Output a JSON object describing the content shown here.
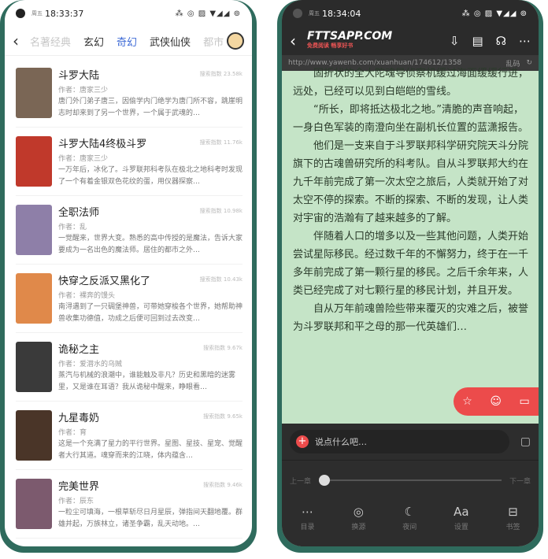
{
  "left": {
    "status": {
      "time": "18:33:37",
      "small": "周五",
      "icons": "⁂ ◎ ▨ ▼◢◢ ⊚"
    },
    "tabs": [
      {
        "label": "名著经典",
        "style": "faded"
      },
      {
        "label": "玄幻",
        "style": "normal"
      },
      {
        "label": "奇幻",
        "style": "active"
      },
      {
        "label": "武侠仙侠",
        "style": "normal"
      },
      {
        "label": "都市",
        "style": "faded"
      }
    ],
    "books": [
      {
        "title": "斗罗大陆",
        "author": "作者：唐家三少",
        "index": "搜索指数 23.58k",
        "desc": "唐门外门弟子唐三，因偷学内门绝学为唐门所不容，跳崖明志时却来到了另一个世界，一个属于武魂的…",
        "cover": "#7a6655"
      },
      {
        "title": "斗罗大陆4终极斗罗",
        "author": "作者：唐家三少",
        "index": "搜索指数 11.76k",
        "desc": "一万年后，冰化了。斗罗联邦科考队在极北之地科考时发现了一个有着金银双色花纹的蛋，用仪器探察…",
        "cover": "#c0392b"
      },
      {
        "title": "全职法师",
        "author": "作者：乱",
        "index": "搜索指数 10.98k",
        "desc": "一觉醒来，世界大变。熟悉的高中传授的是魔法，告诉大家要成为一名出色的魔法师。居住的都市之外…",
        "cover": "#8e7fa8"
      },
      {
        "title": "快穿之反派又黑化了",
        "author": "作者：裸奔的馒头",
        "index": "搜索指数 10.43k",
        "desc": "南浔遇到了一只碉堡神兽，可带她穿梭各个世界，她帮助神兽收集功德值，功成之后便可回到过去改变…",
        "cover": "#e0894a"
      },
      {
        "title": "诡秘之主",
        "author": "作者：爱潜水的乌贼",
        "index": "搜索指数 9.67k",
        "desc": "蒸汽与机械的浪潮中，谁能触及非凡？历史和黑暗的迷雾里，又是谁在耳语？我从诡秘中醒来，睁眼看…",
        "cover": "#3a3a3a"
      },
      {
        "title": "九星毒奶",
        "author": "作者：育",
        "index": "搜索指数 9.65k",
        "desc": "这是一个充满了星力的平行世界。星图、星技、星宠、觉醒者大行其道。魂穿而来的江晓，体内蕴含…",
        "cover": "#4a3528"
      },
      {
        "title": "完美世界",
        "author": "作者：辰东",
        "index": "搜索指数 9.46k",
        "desc": "一粒尘可填海，一根草斩尽日月星辰，弹指间天翻地覆。群雄并起，万族林立，诸圣争霸，乱天动地。…",
        "cover": "#7c5a6e"
      }
    ]
  },
  "right": {
    "status": {
      "time": "18:34:04",
      "small": "周五",
      "icons": "⁂ ◎ ▨ ▼◢◢ ⊚"
    },
    "logo": "FTTSAPP.COM",
    "logo_sub": "免费阅读 畅享好书",
    "url": "http://www.yawenb.com/xuanhuan/174612/1358",
    "garble_label": "乱码",
    "paragraphs": [
      "固折状的全大陀魂导侦察机缓过海面缓缓行进，远处，已经可以见到白皑皑的雪线。",
      "“所长，即将抵达极北之地。”清脆的声音响起，一身白色军装的南澄向坐在副机长位置的蓝潇报告。",
      "他们是一支来自于斗罗联邦科学研究院天斗分院旗下的古魂兽研究所的科考队。自从斗罗联邦大约在九千年前完成了第一次太空之旅后，人类就开始了对太空不停的探索。不断的探索、不断的发现，让人类对宇宙的浩瀚有了越来越多的了解。",
      "伴随着人口的增多以及一些其他问题，人类开始尝试星际移民。经过数千年的不懈努力，终于在一千多年前完成了第一颗行星的移民。之后千余年来，人类已经完成了对七颗行星的移民计划，并且开发。",
      "自从万年前魂兽险些带来覆灭的灾难之后，被誉为斗罗联邦和平之母的那一代英雄们…"
    ],
    "comment_placeholder": "说点什么吧…",
    "prev_label": "上一章",
    "next_label": "下一章",
    "nav": [
      {
        "label": "目录",
        "icon": "toc-icon",
        "glyph": "⋯"
      },
      {
        "label": "换源",
        "icon": "source-icon",
        "glyph": "◎"
      },
      {
        "label": "夜间",
        "icon": "moon-icon",
        "glyph": "☾"
      },
      {
        "label": "设置",
        "icon": "font-icon",
        "glyph": "Aa"
      },
      {
        "label": "书签",
        "icon": "bookmark-icon",
        "glyph": "⊟"
      }
    ]
  }
}
